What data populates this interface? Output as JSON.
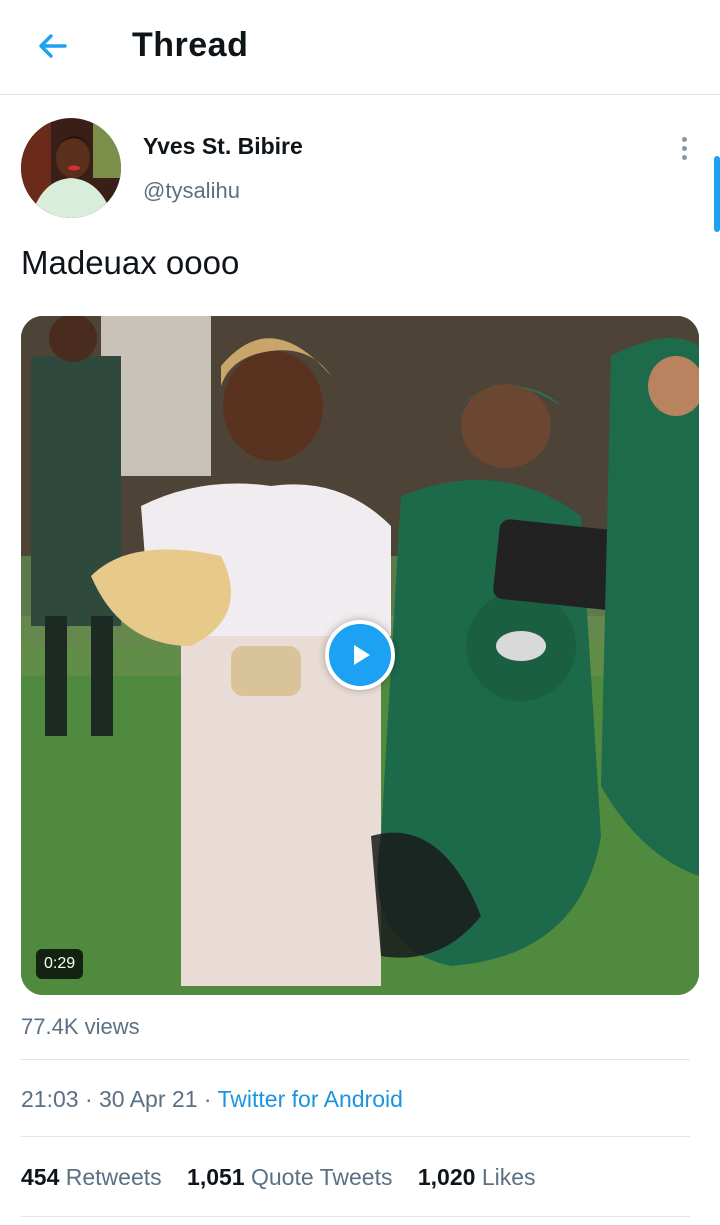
{
  "header": {
    "title": "Thread"
  },
  "tweet": {
    "author_name": "Yves St. Bibire",
    "author_handle": "@tysalihu",
    "text": "Madeuax oooo",
    "video_duration": "0:29",
    "views": "77.4K views",
    "time": "21:03",
    "date": "30 Apr 21",
    "separator": "·",
    "source": "Twitter for Android"
  },
  "stats": {
    "retweets_count": "454",
    "retweets_label": "Retweets",
    "quotes_count": "1,051",
    "quotes_label": "Quote Tweets",
    "likes_count": "1,020",
    "likes_label": "Likes"
  },
  "icons": {
    "back": "arrow-left-icon",
    "more": "more-vertical-icon",
    "play": "play-icon"
  },
  "colors": {
    "accent": "#1da1f2",
    "link": "#1b95e0",
    "muted": "#5b7083",
    "text": "#0f1419"
  }
}
